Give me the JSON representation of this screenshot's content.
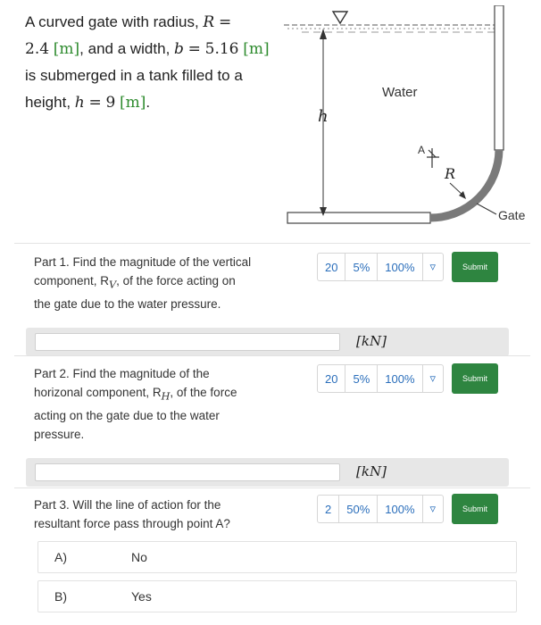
{
  "problem": {
    "intro": "A curved gate with radius,",
    "R_sym": "R",
    "eq": "=",
    "R_val": "2.4",
    "R_unit": "[m]",
    "and_width": ", and a width,",
    "b_sym": "b",
    "b_val": "5.16",
    "b_unit": "[m]",
    "submerged": "is submerged in a tank filled to a",
    "height": "height,",
    "h_sym": "h",
    "h_val": "9",
    "h_unit": "[m]",
    "period": "."
  },
  "diagram": {
    "water": "Water",
    "h": "h",
    "A": "A",
    "R": "R",
    "gate": "Gate"
  },
  "parts": [
    {
      "lines": [
        "Part 1. Find the magnitude of the vertical",
        "component, R",
        "V",
        ", of the force acting on",
        "the gate due to the water pressure."
      ],
      "controls": [
        "20",
        "5%",
        "100%",
        "▿"
      ],
      "submit": "Submit",
      "unit": "[kN]"
    },
    {
      "lines": [
        "Part 2. Find the magnitude of the",
        "horizonal component, R",
        "H",
        ", of the force",
        "acting on the gate due to the water",
        "pressure."
      ],
      "controls": [
        "20",
        "5%",
        "100%",
        "▿"
      ],
      "submit": "Submit",
      "unit": "[kN]"
    },
    {
      "lines": [
        "Part 3. Will the line of action for the",
        "resultant force pass through point A?"
      ],
      "controls": [
        "2",
        "50%",
        "100%",
        "▿"
      ],
      "submit": "Submit"
    }
  ],
  "choices": [
    {
      "letter": "A)",
      "text": "No"
    },
    {
      "letter": "B)",
      "text": "Yes"
    }
  ],
  "colors": {
    "submit": "#2e8540",
    "unit_green": "#2e8b2e",
    "control_blue": "#2a6ebb",
    "gate": "#7a7a7a"
  }
}
